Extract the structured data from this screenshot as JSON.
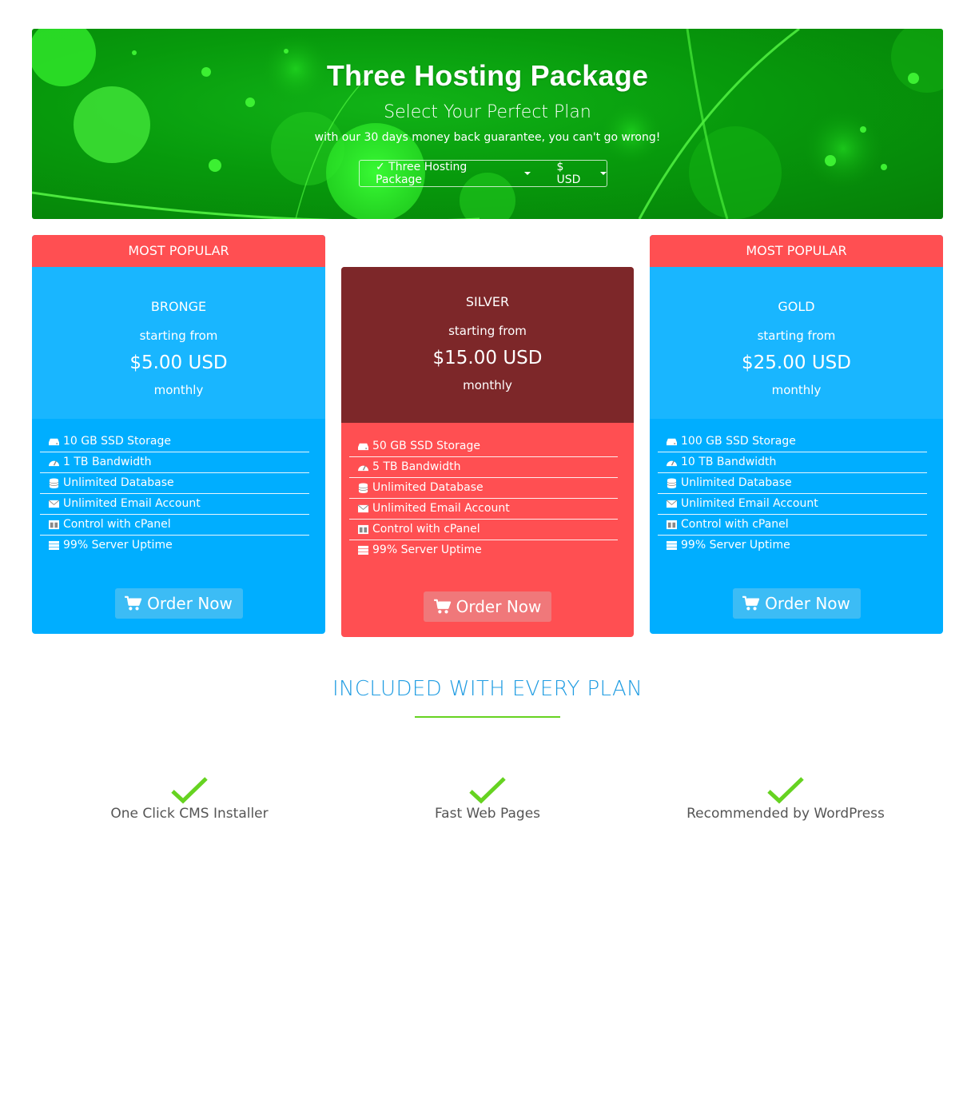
{
  "hero": {
    "title": "Three Hosting Package",
    "subtitle": "Select Your Perfect Plan",
    "tagline": "with our 30 days money back guarantee, you can't go wrong!",
    "package_selector": "✓ Three Hosting Package",
    "currency_selector": "$ USD"
  },
  "colors": {
    "hero_green": "#079a0c",
    "card_blue": "#00aeff",
    "card_blue_head": "#19b6ff",
    "silver_red": "#ff4f52",
    "silver_head": "#7d2729",
    "accent_blue": "#1f9ce2",
    "check_green": "#66d321"
  },
  "plans": [
    {
      "ribbon": "MOST POPULAR",
      "name": "BRONGE",
      "starting": "starting from",
      "price": "$5.00 USD",
      "period": "monthly",
      "features": [
        "10 GB SSD Storage",
        "1 TB Bandwidth",
        "Unlimited Database",
        "Unlimited Email Account",
        "Control with cPanel",
        "99% Server Uptime"
      ],
      "order_label": "Order Now"
    },
    {
      "ribbon": "",
      "name": "SILVER",
      "starting": "starting from",
      "price": "$15.00 USD",
      "period": "monthly",
      "features": [
        "50 GB SSD Storage",
        "5 TB Bandwidth",
        "Unlimited Database",
        "Unlimited Email Account",
        "Control with cPanel",
        "99% Server Uptime"
      ],
      "order_label": "Order Now"
    },
    {
      "ribbon": "MOST POPULAR",
      "name": "GOLD",
      "starting": "starting from",
      "price": "$25.00 USD",
      "period": "monthly",
      "features": [
        "100 GB SSD Storage",
        "10 TB Bandwidth",
        "Unlimited Database",
        "Unlimited Email Account",
        "Control with cPanel",
        "99% Server Uptime"
      ],
      "order_label": "Order Now"
    }
  ],
  "feature_icons": [
    "hdd-icon",
    "tachometer-icon",
    "database-icon",
    "envelope-icon",
    "columns-icon",
    "server-icon"
  ],
  "included": {
    "title": "INCLUDED WITH EVERY PLAN",
    "items": [
      "One Click CMS Installer",
      "Fast Web Pages",
      "Recommended by WordPress"
    ]
  }
}
